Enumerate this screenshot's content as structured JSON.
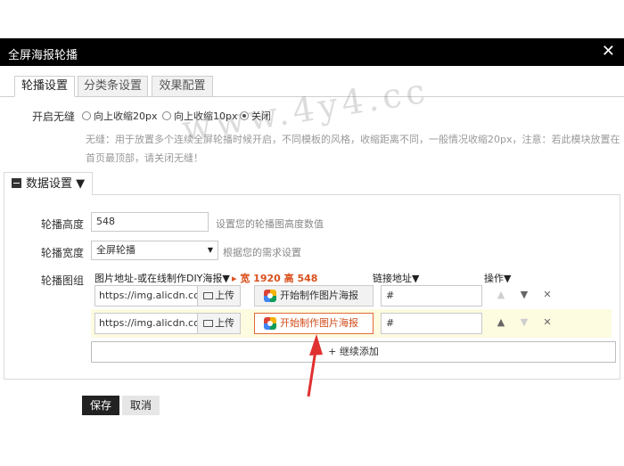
{
  "window": {
    "title": "全屏海报轮播",
    "close": "✕"
  },
  "tabs": [
    {
      "label": "轮播设置",
      "active": true
    },
    {
      "label": "分类条设置",
      "active": false
    },
    {
      "label": "效果配置",
      "active": false
    }
  ],
  "seamless": {
    "label": "开启无缝",
    "options": [
      {
        "label": "向上收缩20px",
        "selected": false
      },
      {
        "label": "向上收缩10px",
        "selected": false
      },
      {
        "label": "关闭",
        "selected": true
      }
    ],
    "hint": "无缝：用于放置多个连续全屏轮播时候开启，不同模板的风格，收缩距离不同，一般情况收缩20px，注意：若此模块放置在首页最顶部，请关闭无缝！"
  },
  "data_section": {
    "title": "数据设置 ▼",
    "height": {
      "label": "轮播高度",
      "value": "548",
      "hint": "设置您的轮播图高度数值"
    },
    "width": {
      "label": "轮播宽度",
      "value": "全屏轮播",
      "hint": "根据您的需求设置"
    },
    "group": {
      "label": "轮播图组",
      "col_image": "图片地址-或在线制作DIY海报▼",
      "col_size": "▸ 宽 1920 高 548",
      "col_link": "链接地址▼",
      "col_ops": "操作▼",
      "upload_label": "上传",
      "make_label": "开始制作图片海报",
      "rows": [
        {
          "url": "https://img.alicdn.com",
          "link": "#"
        },
        {
          "url": "https://img.alicdn.com",
          "link": "#"
        }
      ],
      "add_label": "+ 继续添加"
    }
  },
  "footer": {
    "save": "保存",
    "cancel": "取消"
  },
  "watermark": "www.4y4.cc",
  "colors": {
    "titlebar": "#000000",
    "accent": "#d9501c",
    "highlight_row": "#fdfbe0",
    "arrow": "#e03030"
  }
}
